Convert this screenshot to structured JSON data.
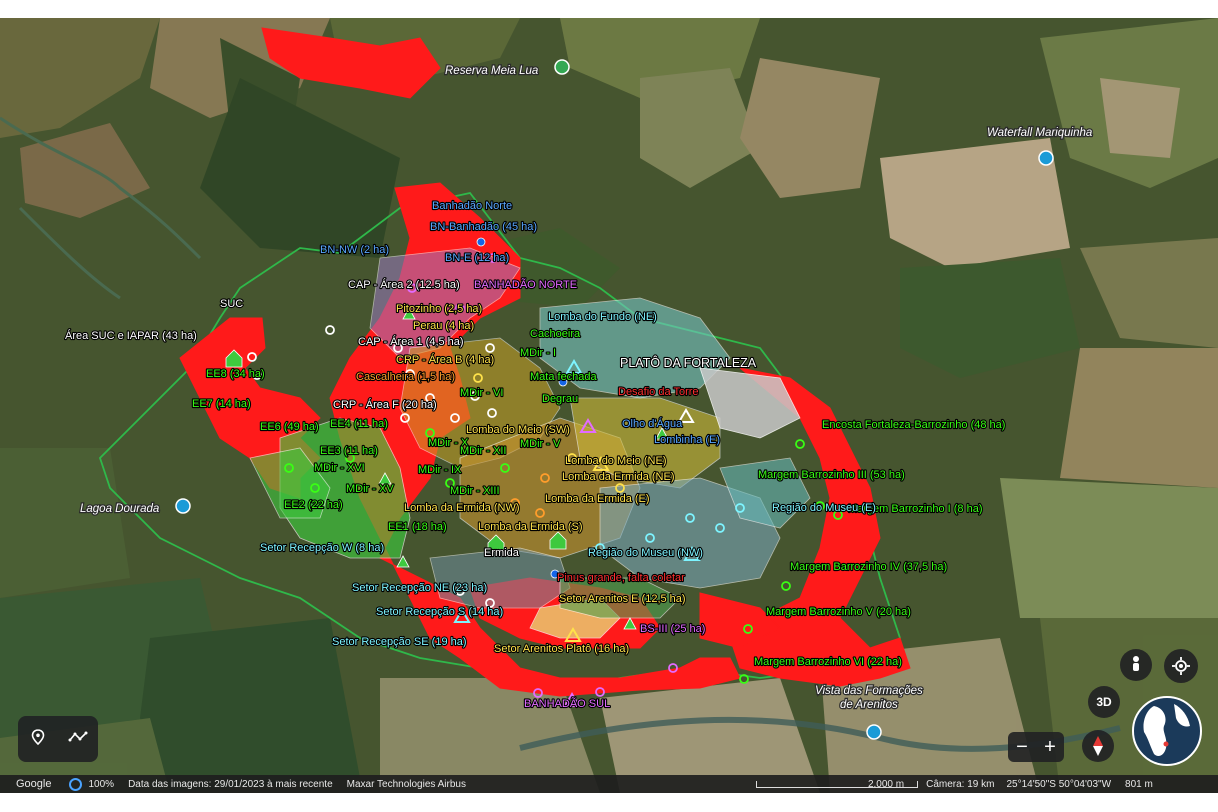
{
  "colors": {
    "fire_red": "#ff1a1a",
    "boundary_green": "#2fb84a",
    "status_bg": "#1e1e1e"
  },
  "places": {
    "reserva": "Reserva Meia Lua",
    "waterfall": "Waterfall Mariquinha",
    "lagoa": "Lagoa Dourada",
    "vista_line1": "Vista das Formações",
    "vista_line2": "de Arenitos"
  },
  "labels": {
    "banhadao_norte_title": "Banhadão Norte",
    "bn_banhadao": "BN-Banhadão (45 ha)",
    "bn_nw": "BN-NW (2 ha)",
    "bn_e": "BN-E (12 ha)",
    "cap_area2": "CAP - Área 2 (12.5 ha)",
    "banhadao_norte_caps": "BANHADÃO NORTE",
    "suc": "SUC",
    "pitozinho": "Pitozinho (2,5 ha)",
    "area_suc": "Área SUC e IAPAR (43 ha)",
    "perau": "Perau (4 ha)",
    "cachoeira": "Cachoeira",
    "lomba_fundo": "Lomba do Fundo (NE)",
    "cap_area1": "CAP - Área 1 (4,5 ha)",
    "mdir_i": "MDir - I",
    "crp_areab": "CRP - Área B (4 ha)",
    "plato": "PLATÔ DA FORTALEZA",
    "ee8": "EE8 (34 ha)",
    "mata_fechada": "Mata fechada",
    "cascalheira": "Cascalheira (1,5 ha)",
    "desafio_torre": "Desafio da Torre",
    "ee7": "EE7 (14 ha)",
    "crp_areaf": "CRP - Área F (20 ha)",
    "mdir_vi": "MDir - VI",
    "degrau": "Degrau",
    "ee6": "EE6 (49 ha)",
    "ee4": "EE4 (11 ha)",
    "lomba_meio_sw": "Lomba do Meio (SW)",
    "olho_agua": "Olho d'Água",
    "encosta": "Encosta Fortaleza-Barrozinho (48 ha)",
    "mdir_x": "MDir - X",
    "mdir_xii": "MDir - XII",
    "mdir_v": "MDir - V",
    "lombinha": "Lombinha (E)",
    "ee3": "EE3 (11 ha)",
    "mdir_xvi": "MDir - XVI",
    "lomba_meio_ne": "Lomba do Meio (NE)",
    "mdir_ix": "MDir - IX",
    "lomba_ermida_ne": "Lomba da Ermida (NE)",
    "margem3": "Margem Barrozinho III (53 ha)",
    "mdir_xv": "MDir - XV",
    "mdir_xiii": "MDir - XIII",
    "lomba_ermida_e": "Lomba da Ermida (E)",
    "margem1": "Margem Barrozinho I (8 ha)",
    "ee2": "EE2 (22 ha)",
    "lomba_ermida_nw": "Lomba da Ermida (NW)",
    "lomba_ermida_s": "Lomba da Ermida (S)",
    "regiao_museu_e": "Região do Museu (E)",
    "ee1": "EE1 (18 ha)",
    "setor_recepcao_w": "Setor Recepção W (8 ha)",
    "ermida": "Ermida",
    "regiao_museu_nw": "Região do Museu (NW)",
    "margem4": "Margem Barrozinho IV (37,5 ha)",
    "pinus": "Pinus grande, falta coletar",
    "setor_recepcao_ne": "Setor Recepção NE (23 ha)",
    "setor_arenitos_e": "Setor Arenitos E (12,5 ha)",
    "setor_recepcao_s": "Setor Recepção S (14 ha)",
    "margem5": "Margem Barrozinho V (20 ha)",
    "bs3": "BS-III (25 ha)",
    "setor_recepcao_se": "Setor Recepção SE (19 ha)",
    "setor_arenitos_plato": "Setor Arenitos Platô (16 ha)",
    "margem6": "Margem Barrozinho VI (22 ha)",
    "banhadao_sul": "BANHADÃO SUL"
  },
  "controls": {
    "btn_3d": "3D",
    "zoom_out": "−",
    "zoom_in": "+"
  },
  "status": {
    "google": "Google",
    "percent": "100%",
    "image_date": "Data das imagens: 29/01/2023 à mais recente",
    "providers": "Maxar Technologies  Airbus",
    "scale": "2.000 m",
    "camera": "Câmera: 19 km",
    "coords": "25°14'50\"S 50°04'03\"W",
    "altitude": "801 m"
  }
}
